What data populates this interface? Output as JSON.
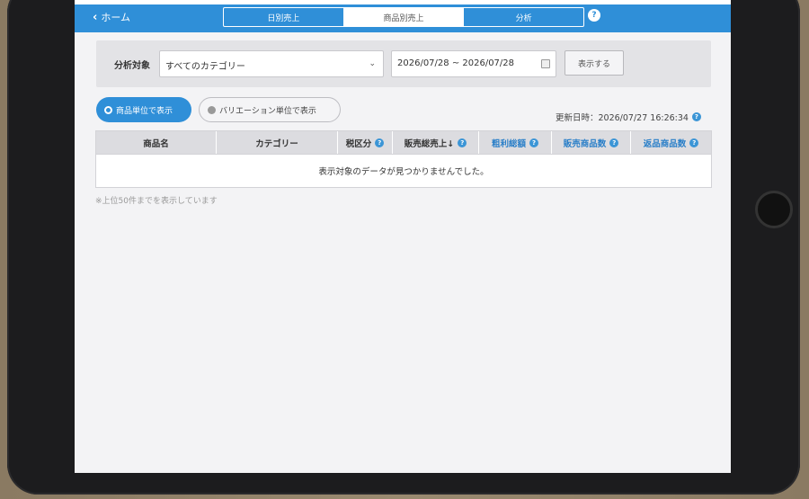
{
  "header": {
    "back_label": "ホーム",
    "tabs": [
      {
        "label": "日別売上",
        "active": false
      },
      {
        "label": "商品別売上",
        "active": true
      },
      {
        "label": "分析",
        "active": false
      }
    ],
    "help_glyph": "?"
  },
  "filter": {
    "label": "分析対象",
    "category_value": "すべてのカテゴリー",
    "date_range": "2026/07/28 ~ 2026/07/28",
    "submit_label": "表示する"
  },
  "view_toggle": {
    "product_label": "商品単位で表示",
    "variation_label": "バリエーション単位で表示",
    "selected": "product"
  },
  "updated": {
    "text": "更新日時：2026/07/27 16:26:34"
  },
  "table": {
    "columns": [
      {
        "label": "商品名"
      },
      {
        "label": "カテゴリー"
      },
      {
        "label": "税区分"
      },
      {
        "label": "販売総売上↓"
      },
      {
        "label": "粗利総額"
      },
      {
        "label": "販売商品数"
      },
      {
        "label": "返品商品数"
      }
    ],
    "empty_message": "表示対象のデータが見つかりませんでした。"
  },
  "footnote": "※上位50件までを表示しています",
  "colors": {
    "accent": "#2f8fd8",
    "link_header": "#2a7fc8"
  }
}
